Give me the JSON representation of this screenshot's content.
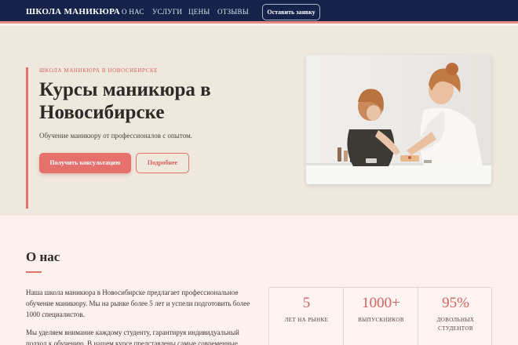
{
  "header": {
    "logo": "ШКОЛА МАНИКЮРА",
    "nav": [
      "О НАС",
      "УСЛУГИ",
      "ЦЕНЫ",
      "ОТЗЫВЫ"
    ],
    "cta": "Оставить заявку"
  },
  "hero": {
    "eyebrow": "ШКОЛА МАНИКЮРА В НОВОСИБИРСКЕ",
    "title": "Курсы маникюра в Новосибирске",
    "subtitle": "Обучение маникюру от профессионалов с опытом.",
    "primary_button": "Получить консультацию",
    "secondary_button": "Подробнее"
  },
  "about": {
    "title": "О нас",
    "paragraph1": "Наша школа маникюра в Новосибирске предлагает профессиональное обучение маникюру. Мы на рынке более 5 лет и успели подготовить более 1000 специалистов.",
    "paragraph2": "Мы уделяем внимание каждому студенту, гарантируя индивидуальный подход к обучению. В нашем курсе представлены самые современные техники маникюра"
  },
  "stats": [
    {
      "value": "5",
      "label": "ЛЕТ НА РЫНКЕ"
    },
    {
      "value": "1000+",
      "label": "ВЫПУСКНИКОВ"
    },
    {
      "value": "95%",
      "label": "ДОВОЛЬНЫХ СТУДЕНТОВ"
    }
  ],
  "colors": {
    "header_bg": "#15234a",
    "accent": "#e6716c",
    "hero_bg": "#efe8dd",
    "page_bg": "#fdf1ee"
  }
}
